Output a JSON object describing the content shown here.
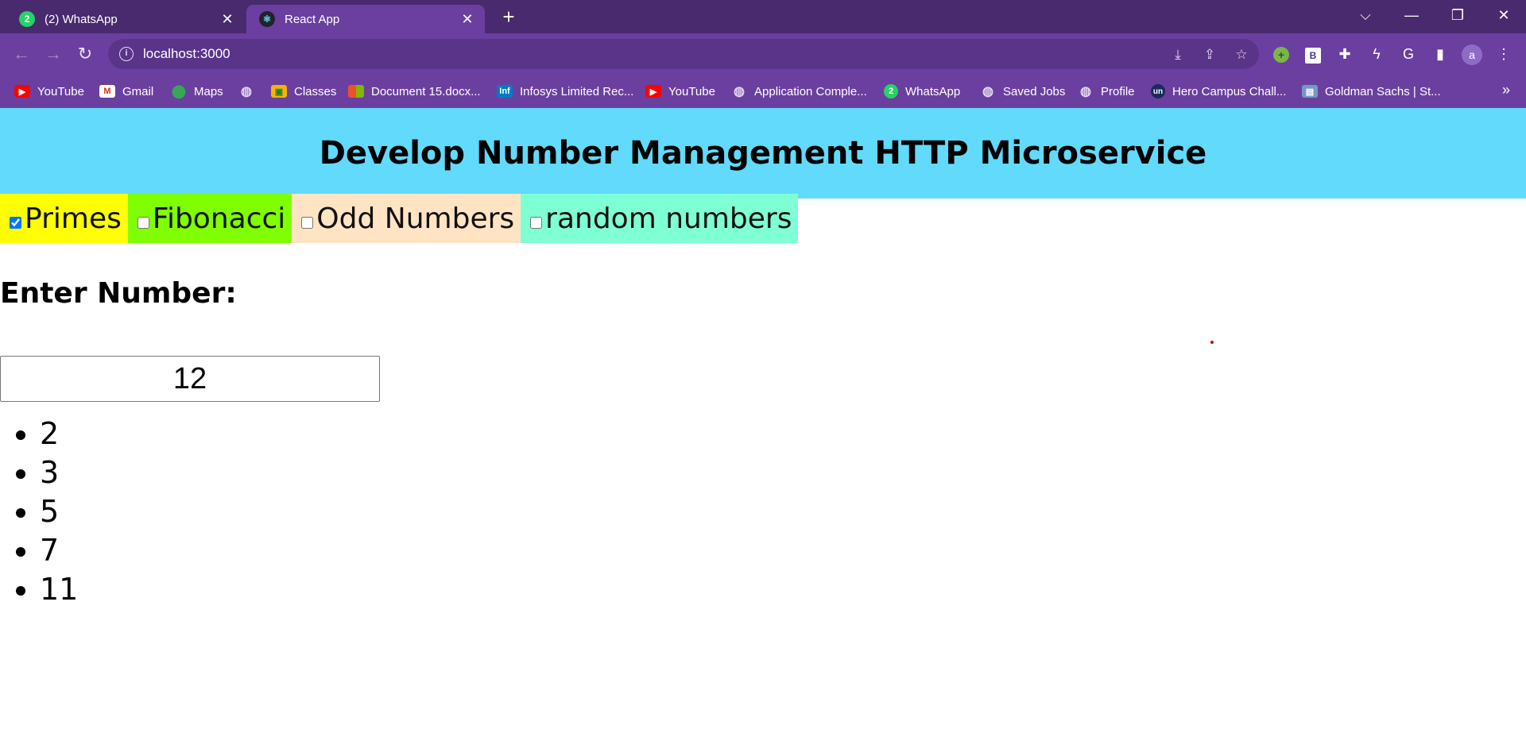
{
  "browser": {
    "tabs": [
      {
        "title": "(2) WhatsApp",
        "favicon": "whatsapp-icon",
        "active": false
      },
      {
        "title": "React App",
        "favicon": "react-icon",
        "active": true
      }
    ],
    "new_tab_symbol": "+",
    "url": "localhost:3000",
    "avatar_letter": "a",
    "bookmarks": [
      {
        "label": "YouTube",
        "icon": "youtube-icon",
        "glyph": "▶"
      },
      {
        "label": "Gmail",
        "icon": "gmail-icon",
        "glyph": "M"
      },
      {
        "label": "Maps",
        "icon": "maps-icon",
        "glyph": "⬤"
      },
      {
        "label": "",
        "icon": "globe-icon",
        "glyph": "◍"
      },
      {
        "label": "Classes",
        "icon": "classroom-icon",
        "glyph": "▣"
      },
      {
        "label": "Document 15.docx...",
        "icon": "microsoft-icon",
        "glyph": ""
      },
      {
        "label": "Infosys Limited Rec...",
        "icon": "infosys-icon",
        "glyph": "Inf"
      },
      {
        "label": "YouTube",
        "icon": "youtube-icon",
        "glyph": "▶"
      },
      {
        "label": "Application Comple...",
        "icon": "globe-icon",
        "glyph": "◍"
      },
      {
        "label": "WhatsApp",
        "icon": "whatsapp-icon",
        "glyph": "2"
      },
      {
        "label": "Saved Jobs",
        "icon": "globe-icon",
        "glyph": "◍"
      },
      {
        "label": "Profile",
        "icon": "globe-icon",
        "glyph": "◍"
      },
      {
        "label": "Hero Campus Chall...",
        "icon": "unstop-icon",
        "glyph": "un"
      },
      {
        "label": "Goldman Sachs | St...",
        "icon": "goldman-sachs-icon",
        "glyph": "▤"
      }
    ],
    "bookmarks_more": "»"
  },
  "app": {
    "title": "Develop Number Management HTTP Microservice",
    "filters": [
      {
        "label": "Primes",
        "checked": true,
        "color": "#ffff00"
      },
      {
        "label": "Fibonacci",
        "checked": false,
        "color": "#7fff00"
      },
      {
        "label": "Odd Numbers",
        "checked": false,
        "color": "#ffe4c4"
      },
      {
        "label": "random numbers",
        "checked": false,
        "color": "#7fffd4"
      }
    ],
    "enter_label": "Enter Number:",
    "input_value": "12",
    "results": [
      "2",
      "3",
      "5",
      "7",
      "11"
    ],
    "header_color": "#61dafb"
  }
}
